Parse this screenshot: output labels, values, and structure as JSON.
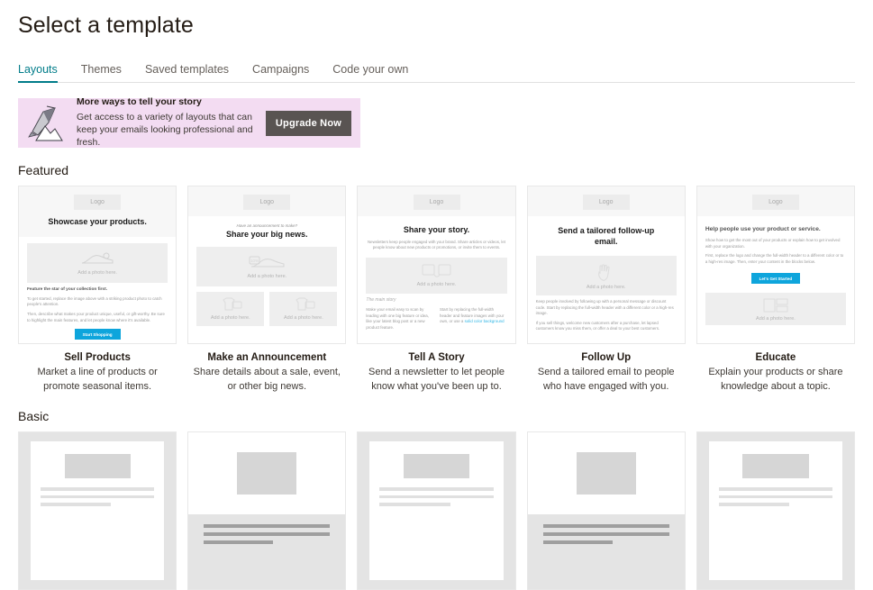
{
  "header": {
    "title": "Select a template"
  },
  "tabs": [
    {
      "label": "Layouts",
      "active": true
    },
    {
      "label": "Themes",
      "active": false
    },
    {
      "label": "Saved templates",
      "active": false
    },
    {
      "label": "Campaigns",
      "active": false
    },
    {
      "label": "Code your own",
      "active": false
    }
  ],
  "promo": {
    "heading": "More ways to tell your story",
    "body": "Get access to a variety of layouts that can keep your emails looking professional and fresh.",
    "button": "Upgrade Now",
    "background": "#f3dcf2",
    "button_color": "#595452",
    "art": "mountain-flag-illustration"
  },
  "sections": {
    "featured": {
      "title": "Featured"
    },
    "basic": {
      "title": "Basic"
    }
  },
  "featured_cards": [
    {
      "title": "Sell Products",
      "desc": "Market a line of products or promote seasonal items.",
      "logo": "Logo",
      "headline": "Showcase your products.",
      "photo_caption": "Add a photo here.",
      "body_bold": "Feature the star of your collection first.",
      "body_1": "To get started, replace the image above with a striking product photo to catch people's attention.",
      "body_2": "Then, describe what makes your product unique, useful, or gift-worthy. Be sure to highlight the main features, and let people know where it's available.",
      "cta": "Start Shopping"
    },
    {
      "title": "Make an Announcement",
      "desc": "Share details about a sale, event, or other big news.",
      "logo": "Logo",
      "kicker": "Have an announcement to make?",
      "headline": "Share your big news.",
      "photo_caption": "Add a photo here.",
      "photo_caption_2": "Add a photo here.",
      "photo_caption_3": "Add a photo here."
    },
    {
      "title": "Tell A Story",
      "desc": "Send a newsletter to let people know what you've been up to.",
      "logo": "Logo",
      "headline": "Share your story.",
      "intro": "Newsletters keep people engaged with your brand. Share articles or videos, let people know about new products or promotions, or invite them to events.",
      "photo_caption": "Add a photo here.",
      "sub_head": "The main story",
      "col_left": "Make your email easy to scan by leading with one big feature or idea, like your latest blog post or a new product feature.",
      "col_right": "Start by replacing the full-width header and feature images with your own, or use a ",
      "col_right_link": "solid color background"
    },
    {
      "title": "Follow Up",
      "desc": "Send a tailored email to people who have engaged with you.",
      "logo": "Logo",
      "headline": "Send a tailored follow-up email.",
      "photo_caption": "Add a photo here.",
      "body_1": "Keep people involved by following up with a personal message or discount code. Start by replacing the full-width header with a different color or a high-res image.",
      "body_2": "If you sell things, welcome new customers after a purchase, let lapsed customers know you miss them, or offer a deal to your best customers."
    },
    {
      "title": "Educate",
      "desc": "Explain your products or share knowledge about a topic.",
      "logo": "Logo",
      "headline": "Help people use your product or service.",
      "body_1": "Show how to get the most out of your products or explain how to get involved with your organization.",
      "body_2": "First, replace the logo and change the full-width header to a different color or to a high-res image. Then, enter your content in the blocks below.",
      "cta": "Let's Get Started",
      "photo_caption": "Add a photo here."
    }
  ],
  "basic_cards": [
    {
      "name": "basic-layout-1",
      "style": "framed"
    },
    {
      "name": "basic-layout-2",
      "style": "split"
    },
    {
      "name": "basic-layout-3",
      "style": "framed"
    },
    {
      "name": "basic-layout-4",
      "style": "split"
    },
    {
      "name": "basic-layout-5",
      "style": "framed"
    }
  ],
  "colors": {
    "accent": "#007c89",
    "cta_blue": "#0ea5dc",
    "link_blue": "#2fb5e5",
    "text": "#241c15"
  }
}
